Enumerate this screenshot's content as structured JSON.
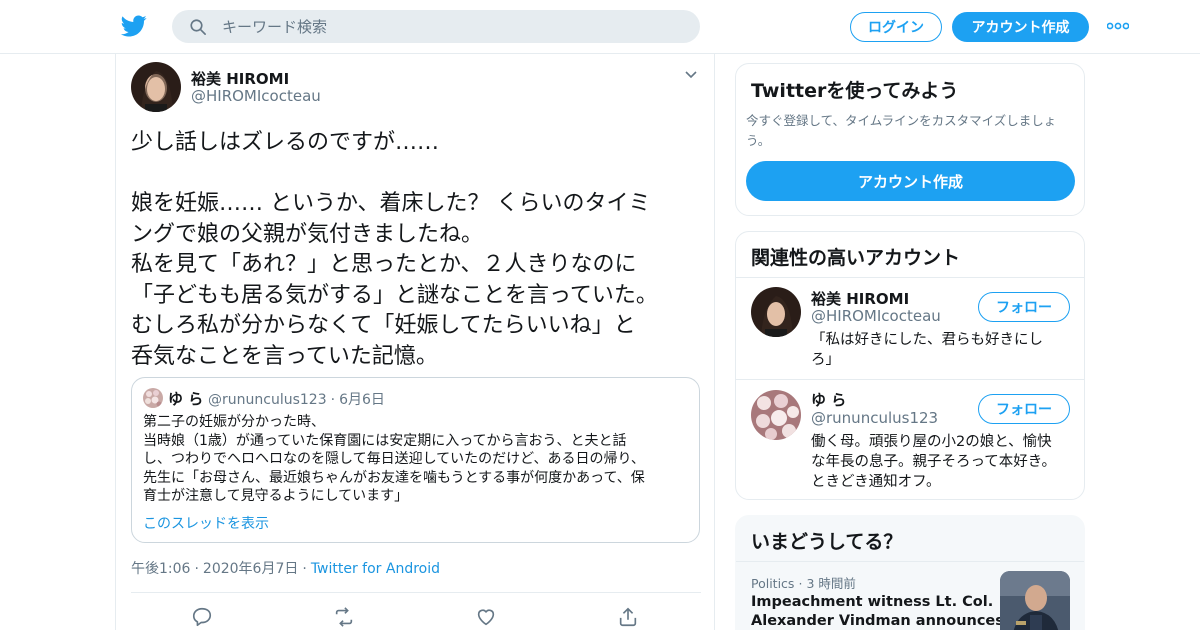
{
  "header": {
    "search_placeholder": "キーワード検索",
    "login_label": "ログイン",
    "signup_label": "アカウント作成",
    "brand_color": "#1da1f2"
  },
  "tweet": {
    "author_name": "裕美 HIROMI",
    "author_handle": "@HIROMIcocteau",
    "text_lines": [
      "少し話しはズレるのですが……",
      "",
      "娘を妊娠…… というか、着床した？ くらいのタイミ",
      "ングで娘の父親が気付きましたね。",
      "私を見て「あれ？」と思ったとか、２人きりなのに",
      "「子どもも居る気がする」と謎なことを言っていた。",
      "むしろ私が分からなくて「妊娠してたらいいね」と",
      "呑気なことを言っていた記憶。"
    ],
    "quote": {
      "name": "ゆ ら",
      "handle": "@rununculus123",
      "date": "6月6日",
      "text_lines": [
        "第二子の妊娠が分かった時、",
        "当時娘（1歳）が通っていた保育園には安定期に入ってから言おう、と夫と話",
        "し、つわりでヘロヘロなのを隠して毎日送迎していたのだけど、ある日の帰り、",
        "先生に「お母さん、最近娘ちゃんがお友達を噛もうとする事が何度かあって、保",
        "育士が注意して見守るようにしています」"
      ],
      "thread_link": "このスレッドを表示"
    },
    "time": "午後1:06",
    "date": "2020年6月7日",
    "source": "Twitter for Android",
    "actions": [
      "reply-icon",
      "retweet-icon",
      "like-icon",
      "share-icon"
    ]
  },
  "sidebar": {
    "try_card": {
      "title": "Twitterを使ってみよう",
      "desc_lines": [
        "今すぐ登録して、タイムラインをカスタマイズしましょ",
        "う。"
      ],
      "signup_label": "アカウント作成"
    },
    "related": {
      "title": "関連性の高いアカウント",
      "follow_label": "フォロー",
      "accounts": [
        {
          "name": "裕美 HIROMI",
          "handle": "@HIROMIcocteau",
          "bio_lines": [
            "「私は好きにした、君らも好きにし",
            "ろ」"
          ]
        },
        {
          "name": "ゆ ら",
          "handle": "@rununculus123",
          "bio_lines": [
            "働く母。頑張り屋の小2の娘と、愉快",
            "な年長の息子。親子そろって本好き。",
            "ときどき通知オフ。"
          ]
        }
      ]
    },
    "trends": {
      "title": "いまどうしてる？",
      "category": "Politics",
      "time": "3 時間前",
      "headline_lines": [
        "Impeachment witness Lt. Col.",
        "Alexander Vindman announces his"
      ]
    }
  }
}
